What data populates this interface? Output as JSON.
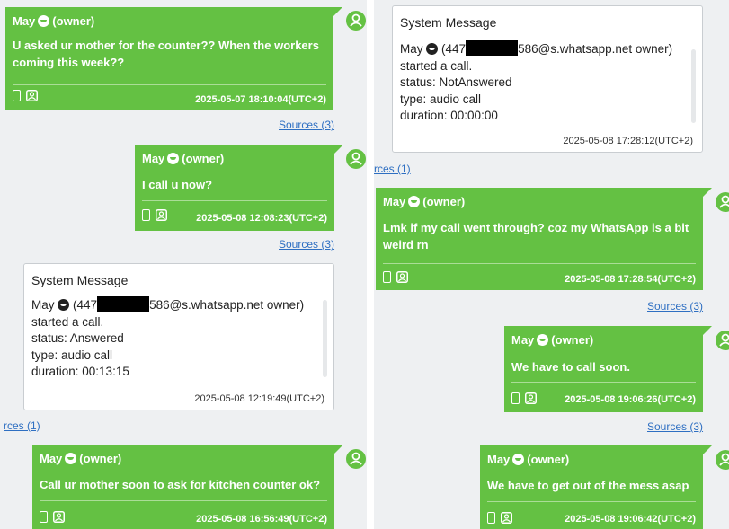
{
  "colors": {
    "bubble": "#64c143",
    "link": "#2e6fc2",
    "panel_bg": "#eef0f2"
  },
  "left": {
    "msg1": {
      "sender": "May",
      "owner": "(owner)",
      "text": "U asked ur mother for the counter?? When the workers coming this week??",
      "timestamp": "2025-05-07 18:10:04(UTC+2)"
    },
    "sources1": "Sources (3)",
    "msg2": {
      "sender": "May",
      "owner": "(owner)",
      "text": "I call u now?",
      "timestamp": "2025-05-08 12:08:23(UTC+2)"
    },
    "sources2": "Sources (3)",
    "sys": {
      "title": "System Message",
      "sender": "May",
      "number_prefix": "(447",
      "number_suffix": "586@s.whatsapp.net owner)",
      "line2": "started a call.",
      "line3": "status: Answered",
      "line4": "type: audio call",
      "line5": "duration: 00:13:15",
      "timestamp": "2025-05-08 12:19:49(UTC+2)"
    },
    "sources3": "rces (1)",
    "msg3": {
      "sender": "May",
      "owner": "(owner)",
      "text": "Call ur mother soon to ask for kitchen counter ok?",
      "timestamp": "2025-05-08 16:56:49(UTC+2)"
    }
  },
  "right": {
    "sys": {
      "title": "System Message",
      "sender": "May",
      "number_prefix": "(447",
      "number_suffix": "586@s.whatsapp.net owner)",
      "line2": "started a call.",
      "line3": "status: NotAnswered",
      "line4": "type: audio call",
      "line5": "duration: 00:00:00",
      "timestamp": "2025-05-08 17:28:12(UTC+2)"
    },
    "sources1": "rces (1)",
    "msg1": {
      "sender": "May",
      "owner": "(owner)",
      "text": "Lmk if my call went through? coz my WhatsApp is a bit weird rn",
      "timestamp": "2025-05-08 17:28:54(UTC+2)"
    },
    "sources2": "Sources (3)",
    "msg2": {
      "sender": "May",
      "owner": "(owner)",
      "text": "We have to call soon.",
      "timestamp": "2025-05-08 19:06:26(UTC+2)"
    },
    "sources3": "Sources (3)",
    "msg3": {
      "sender": "May",
      "owner": "(owner)",
      "text": "We have to get out of the mess asap",
      "timestamp": "2025-05-08 19:06:42(UTC+2)"
    }
  },
  "icons": {
    "phone": "phone-icon",
    "contact": "contact-icon",
    "avatar": "user-avatar-icon",
    "emoji": "grinning-emoji-icon"
  }
}
